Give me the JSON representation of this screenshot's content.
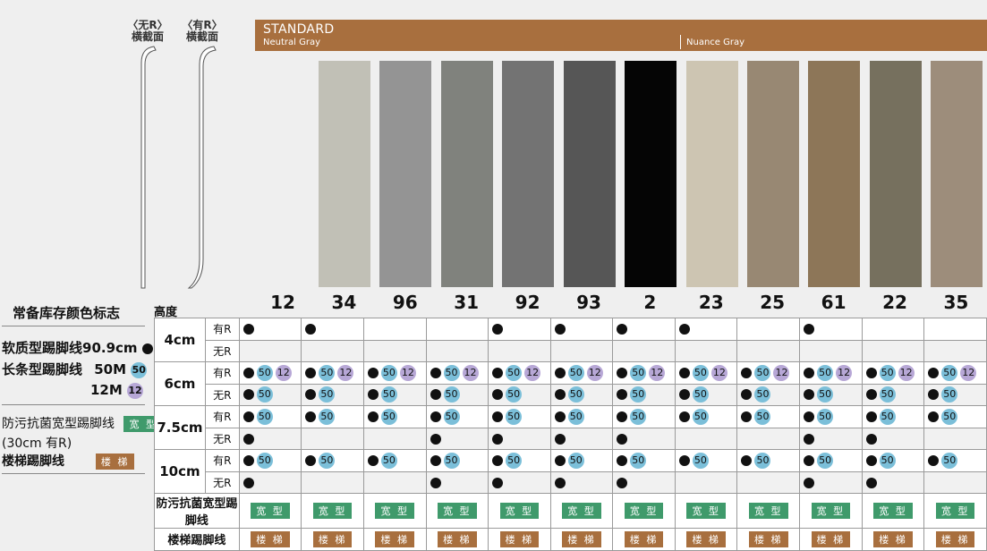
{
  "profiles": {
    "no_r": [
      "〈无R〉",
      "横截面"
    ],
    "with_r": [
      "〈有R〉",
      "横截面"
    ]
  },
  "banner": {
    "title": "STANDARD",
    "neutral": "Neutral Gray",
    "nuance": "Nuance Gray"
  },
  "swatches": [
    {
      "code": "12",
      "color": "#d8d6d0"
    },
    {
      "code": "34",
      "color": "#c1c0b6"
    },
    {
      "code": "96",
      "color": "#949494"
    },
    {
      "code": "31",
      "color": "#80827d"
    },
    {
      "code": "92",
      "color": "#737373"
    },
    {
      "code": "93",
      "color": "#565656"
    },
    {
      "code": "2",
      "color": "#050505"
    },
    {
      "code": "23",
      "color": "#cdc5b2"
    },
    {
      "code": "25",
      "color": "#988873"
    },
    {
      "code": "61",
      "color": "#8d7658"
    },
    {
      "code": "22",
      "color": "#76705e"
    },
    {
      "code": "35",
      "color": "#9d8d7b"
    }
  ],
  "legend": {
    "title": "常备库存颜色标志",
    "soft": "软质型踢脚线90.9cm",
    "long": "长条型踢脚线",
    "m50": "50M",
    "m12": "12M",
    "badge50": "50",
    "badge12": "12",
    "anti_line1": "防污抗菌宽型踢脚线",
    "anti_line2": "(30cm 有R)",
    "stairs": "楼梯踢脚线",
    "wide_tag": "宽 型",
    "stairs_tag": "楼 梯"
  },
  "table": {
    "height_label": "高度",
    "heights": [
      "4cm",
      "6cm",
      "7.5cm",
      "10cm"
    ],
    "with_r": "有R",
    "no_r": "无R",
    "anti_label": "防污抗菌宽型踢脚线",
    "stairs_label": "楼梯踢脚线",
    "rows": [
      {
        "h": 0,
        "r": "with",
        "cells": [
          "D",
          "D",
          "",
          "",
          "D",
          "D",
          "D",
          "D",
          "",
          "D",
          "",
          ""
        ]
      },
      {
        "h": 0,
        "r": "no",
        "cells": [
          "",
          "",
          "",
          "",
          "",
          "",
          "",
          "",
          "",
          "",
          "",
          ""
        ]
      },
      {
        "h": 1,
        "r": "with",
        "cells": [
          "D50 12",
          "D50 12",
          "D50 12",
          "D50 12",
          "D50 12",
          "D50 12",
          "D50 12",
          "D50 12",
          "D50 12",
          "D50 12",
          "D50 12",
          "D50 12"
        ]
      },
      {
        "h": 1,
        "r": "no",
        "cells": [
          "D50",
          "D50",
          "D50",
          "D50",
          "D50",
          "D50",
          "D50",
          "D50",
          "D50",
          "D50",
          "D50",
          "D50"
        ]
      },
      {
        "h": 2,
        "r": "with",
        "cells": [
          "D50",
          "D50",
          "D50",
          "D50",
          "D50",
          "D50",
          "D50",
          "D50",
          "D50",
          "D50",
          "D50",
          "D50"
        ]
      },
      {
        "h": 2,
        "r": "no",
        "cells": [
          "D",
          "",
          "",
          "D",
          "D",
          "D",
          "D",
          "",
          "",
          "D",
          "D",
          ""
        ]
      },
      {
        "h": 3,
        "r": "with",
        "cells": [
          "D50",
          "D50",
          "D50",
          "D50",
          "D50",
          "D50",
          "D50",
          "D50",
          "D50",
          "D50",
          "D50",
          "D50"
        ]
      },
      {
        "h": 3,
        "r": "no",
        "cells": [
          "D",
          "",
          "",
          "D",
          "D",
          "D",
          "D",
          "",
          "",
          "D",
          "D",
          ""
        ]
      }
    ]
  }
}
